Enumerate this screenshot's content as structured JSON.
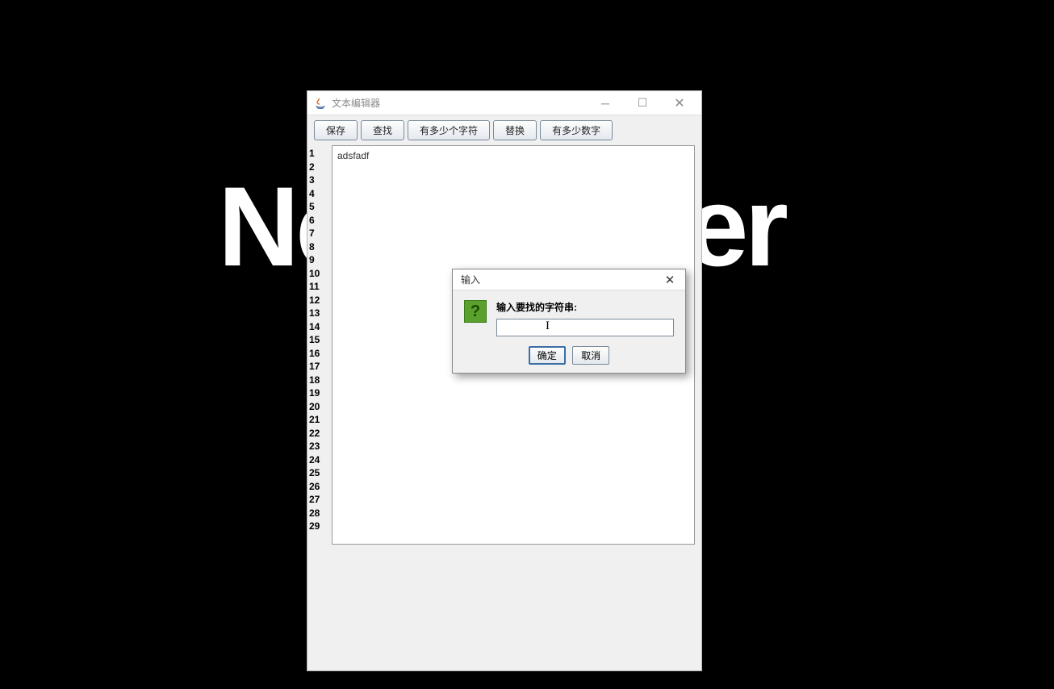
{
  "background_text": "Newspaper",
  "window": {
    "title": "文本编辑器",
    "toolbar": {
      "save": "保存",
      "find": "查找",
      "char_count": "有多少个字符",
      "replace": "替换",
      "digit_count": "有多少数字"
    },
    "line_numbers": [
      "1",
      "2",
      "3",
      "4",
      "5",
      "6",
      "7",
      "8",
      "9",
      "10",
      "11",
      "12",
      "13",
      "14",
      "15",
      "16",
      "17",
      "18",
      "19",
      "20",
      "21",
      "22",
      "23",
      "24",
      "25",
      "26",
      "27",
      "28",
      "29"
    ],
    "editor_content": "adsfadf"
  },
  "dialog": {
    "title": "输入",
    "icon_char": "?",
    "prompt": "输入要找的字符串:",
    "input_value": "",
    "ok": "确定",
    "cancel": "取消"
  }
}
